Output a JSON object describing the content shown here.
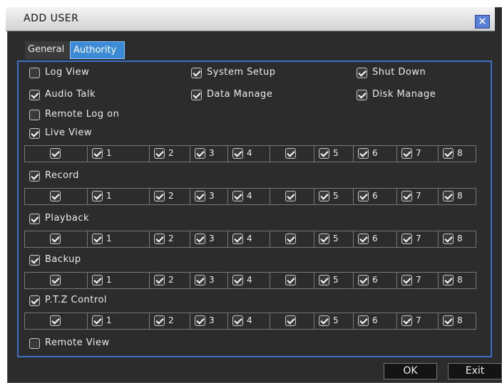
{
  "dialog": {
    "title": "ADD USER",
    "close_label": "✕"
  },
  "tabs": [
    {
      "label": "General",
      "active": false
    },
    {
      "label": "Authority",
      "active": true
    }
  ],
  "permissions": [
    {
      "label": "Log View",
      "checked": false
    },
    {
      "label": "System Setup",
      "checked": true
    },
    {
      "label": "Shut Down",
      "checked": true
    },
    {
      "label": "Audio Talk",
      "checked": true
    },
    {
      "label": "Data Manage",
      "checked": true
    },
    {
      "label": "Disk Manage",
      "checked": true
    },
    {
      "label": "Remote Log on",
      "checked": false
    }
  ],
  "channel_sections": [
    {
      "label": "Live View",
      "checked": true
    },
    {
      "label": "Record",
      "checked": true
    },
    {
      "label": "Playback",
      "checked": true
    },
    {
      "label": "Backup",
      "checked": true
    },
    {
      "label": "P.T.Z Control",
      "checked": true
    }
  ],
  "channel_cells": [
    {
      "num": "",
      "checked": true
    },
    {
      "num": "1",
      "checked": true
    },
    {
      "num": "2",
      "checked": true
    },
    {
      "num": "3",
      "checked": true
    },
    {
      "num": "4",
      "checked": true
    },
    {
      "num": "",
      "checked": true
    },
    {
      "num": "5",
      "checked": true
    },
    {
      "num": "6",
      "checked": true
    },
    {
      "num": "7",
      "checked": true
    },
    {
      "num": "8",
      "checked": true
    }
  ],
  "remote_view": {
    "label": "Remote View",
    "checked": false
  },
  "buttons": {
    "ok": "OK",
    "exit": "Exit"
  }
}
